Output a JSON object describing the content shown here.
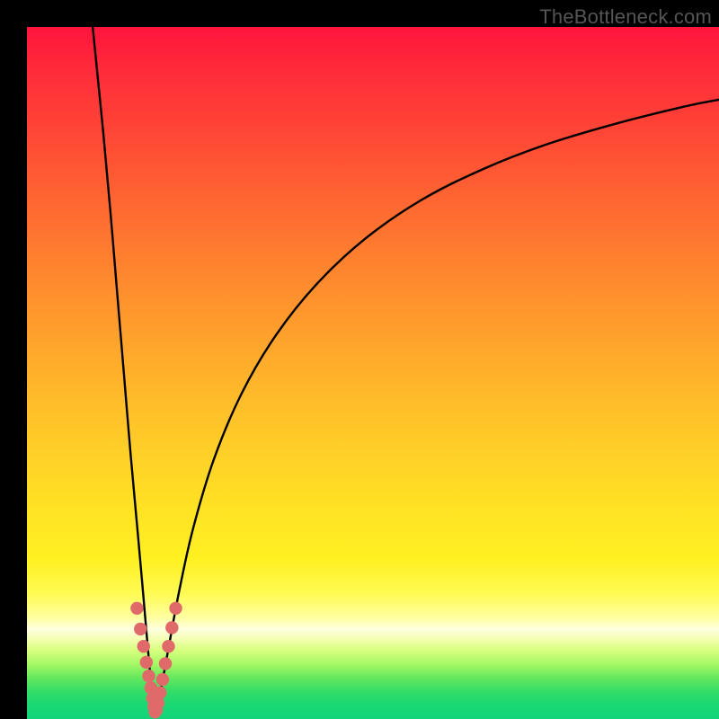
{
  "watermark": {
    "text": "TheBottleneck.com"
  },
  "colors": {
    "curve": "#000000",
    "marker_fill": "#e06a6a",
    "marker_stroke": "#c45555"
  },
  "chart_data": {
    "type": "line",
    "title": "",
    "xlabel": "",
    "ylabel": "",
    "xlim": [
      0,
      100
    ],
    "ylim": [
      0,
      100
    ],
    "grid": false,
    "legend": false,
    "series": [
      {
        "name": "left-branch",
        "x": [
          9.5,
          10.2,
          11.0,
          12.0,
          13.0,
          14.0,
          15.0,
          16.0,
          16.8,
          17.4,
          17.8,
          18.1,
          18.35,
          18.5
        ],
        "y": [
          100,
          93,
          85,
          74,
          62,
          50,
          38,
          27,
          18,
          11,
          6.5,
          3.5,
          1.5,
          0.5
        ]
      },
      {
        "name": "right-branch",
        "x": [
          18.5,
          18.9,
          19.5,
          20.5,
          22.0,
          24.0,
          27.0,
          31.0,
          36.0,
          42.0,
          49.0,
          57.0,
          66.0,
          75.0,
          85.0,
          95.0,
          100.0
        ],
        "y": [
          0.5,
          2.0,
          5.0,
          10.5,
          18.5,
          27.5,
          37.5,
          47.0,
          55.5,
          63.0,
          69.5,
          75.0,
          79.5,
          83.0,
          86.0,
          88.5,
          89.5
        ]
      }
    ],
    "markers": [
      {
        "x": 15.9,
        "y": 16.0
      },
      {
        "x": 16.4,
        "y": 13.0
      },
      {
        "x": 16.85,
        "y": 10.5
      },
      {
        "x": 17.25,
        "y": 8.2
      },
      {
        "x": 17.6,
        "y": 6.2
      },
      {
        "x": 17.9,
        "y": 4.5
      },
      {
        "x": 18.15,
        "y": 3.0
      },
      {
        "x": 18.35,
        "y": 1.8
      },
      {
        "x": 18.5,
        "y": 1.0
      },
      {
        "x": 18.7,
        "y": 1.3
      },
      {
        "x": 18.95,
        "y": 2.3
      },
      {
        "x": 19.25,
        "y": 3.8
      },
      {
        "x": 19.6,
        "y": 5.7
      },
      {
        "x": 20.0,
        "y": 8.0
      },
      {
        "x": 20.45,
        "y": 10.5
      },
      {
        "x": 20.95,
        "y": 13.2
      },
      {
        "x": 21.5,
        "y": 16.0
      }
    ]
  }
}
